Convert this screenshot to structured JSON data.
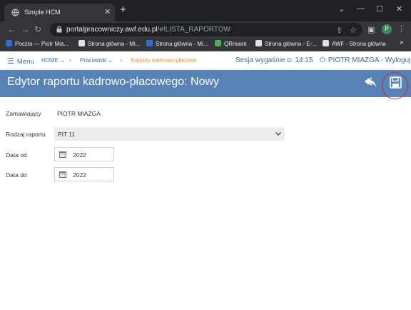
{
  "browser": {
    "tab_title": "Simple HCM",
    "new_tab": "+",
    "url_host": "portalpracowniczy.awf.edu.pl",
    "url_rest": "/#!LISTA_RAPORTOW",
    "profile_initial": "P",
    "bookmarks": [
      {
        "label": "Poczta — Piotr Mia...",
        "color": "#2f6fd6"
      },
      {
        "label": "Strona główna - Mi...",
        "color": "#e1e1e1"
      },
      {
        "label": "Strona główna - Mi...",
        "color": "#2f6fd6"
      },
      {
        "label": "QRmaint",
        "color": "#4caf50"
      },
      {
        "label": "Strona główna - E-...",
        "color": "#e1e1e1"
      },
      {
        "label": "AWF - Strona główna",
        "color": "#e1e1e1"
      }
    ],
    "more_bookmarks": "»"
  },
  "appnav": {
    "menu_label": "Menu",
    "breadcrumbs": [
      "HOME",
      "Pracownik",
      "Raporty kadrowo-płacowe"
    ],
    "session_text": "Sesja wygaśnie o: 14:15",
    "user_text": "PIOTR MIAZGA - Wyloguj"
  },
  "header": {
    "title": "Edytor raportu kadrowo-płacowego: Nowy"
  },
  "form": {
    "requester_label": "Zamawiający",
    "requester_value": "PIOTR MIAZGA",
    "report_type_label": "Rodzaj raportu",
    "report_type_value": "PIT 11",
    "date_from_label": "Data od",
    "date_from_value": "2022",
    "date_to_label": "Data do",
    "date_to_value": "2022"
  },
  "colors": {
    "header_bar": "#5682b5",
    "link": "#3a6ea5",
    "active_crumb": "#e8912d",
    "annotation": "#d8222a"
  }
}
